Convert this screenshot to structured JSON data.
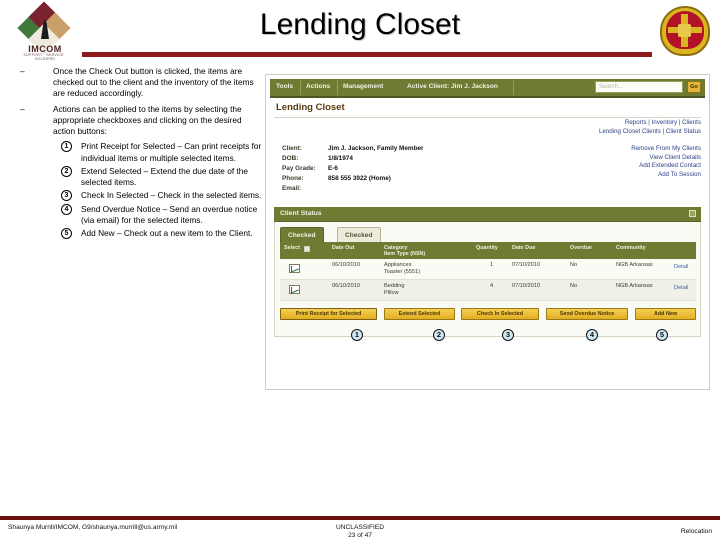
{
  "slide": {
    "title": "Lending Closet",
    "logo_left": {
      "label": "IMCOM",
      "sub": "SUPPORT · SERVICE · SOLDIERS"
    },
    "logo_right_name": "army-imcom-crest"
  },
  "bullets": [
    {
      "dash": "–",
      "text": "Once the Check Out button is clicked, the items are checked out to the client and the inventory of the items are reduced accordingly."
    },
    {
      "dash": "–",
      "text": "Actions can be applied to the items by selecting the appropriate checkboxes and clicking on the desired action buttons:"
    }
  ],
  "numbered": [
    {
      "num": "1",
      "text": "Print Receipt for Selected – Can print receipts for individual items or multiple selected items."
    },
    {
      "num": "2",
      "text": "Extend Selected – Extend the due date of the selected items."
    },
    {
      "num": "3",
      "text": "Check In Selected – Check in the selected items."
    },
    {
      "num": "4",
      "text": "Send Overdue Notice – Send an overdue notice (via email) for the selected items."
    },
    {
      "num": "5",
      "text": "Add New – Check out a new item to the Client."
    }
  ],
  "app": {
    "menu": [
      {
        "label": "Tools"
      },
      {
        "label": "Actions"
      },
      {
        "label": "Management"
      },
      {
        "label": "Active Client: Jim J. Jackson"
      }
    ],
    "search": {
      "placeholder": "Search...",
      "go_label": "Go"
    },
    "page_title": "Lending Closet",
    "nav_primary": "Reports | Inventory | Clients",
    "nav_secondary": "Lending Closet Clients | Client Status",
    "client": [
      {
        "key": "Client:",
        "value": "Jim J. Jackson, Family Member"
      },
      {
        "key": "DOB:",
        "value": "1/8/1974"
      },
      {
        "key": "Pay Grade:",
        "value": "E-6"
      },
      {
        "key": "Phone:",
        "value": "858 555 3922 (Home)"
      },
      {
        "key": "Email:",
        "value": ""
      }
    ],
    "client_links": [
      "Remove From My Clients",
      "View Client Details",
      "Add Extended Contact",
      "Add To Session"
    ],
    "panel": {
      "title": "Client Status"
    },
    "tabs": [
      {
        "label": "Checked Out",
        "active": true
      },
      {
        "label": "Checked In",
        "active": false
      }
    ],
    "table": {
      "headers": [
        "Select",
        "Date Out",
        "Category\nItem Type (NSN)",
        "Quantity",
        "Date Due",
        "Overdue",
        "Community"
      ],
      "rows": [
        {
          "date_out": "06/10/2010",
          "category_item": "Appliances\nToaster (5551)",
          "quantity": "1",
          "date_due": "07/10/2010",
          "overdue": "No",
          "community": "NGB Arkansas",
          "detail": "Detail"
        },
        {
          "date_out": "06/10/2010",
          "category_item": "Bedding\nPillow",
          "quantity": "4",
          "date_due": "07/10/2010",
          "overdue": "No",
          "community": "NGB Arkansas",
          "detail": "Detail"
        }
      ]
    },
    "buttons": [
      {
        "label": "Print Receipt for Selected"
      },
      {
        "label": "Extend Selected"
      },
      {
        "label": "Check In Selected"
      },
      {
        "label": "Send Overdue Notice"
      },
      {
        "label": "Add New"
      }
    ],
    "callouts": [
      "1",
      "2",
      "3",
      "4",
      "5"
    ]
  },
  "footer": {
    "left": "Shaunya Murrill/IMCOM, G9/shaunya.murrill@us.army.mil",
    "center_line1": "UNCLASSIFIED",
    "center_line2": "23 of 47",
    "right": "Relocation"
  },
  "colors": {
    "accent_red": "#8c1a1a",
    "olive": "#6f7a33",
    "gold": "#e2ad22",
    "link_blue": "#2a3f86",
    "callout_fill": "#cfe9f2"
  }
}
